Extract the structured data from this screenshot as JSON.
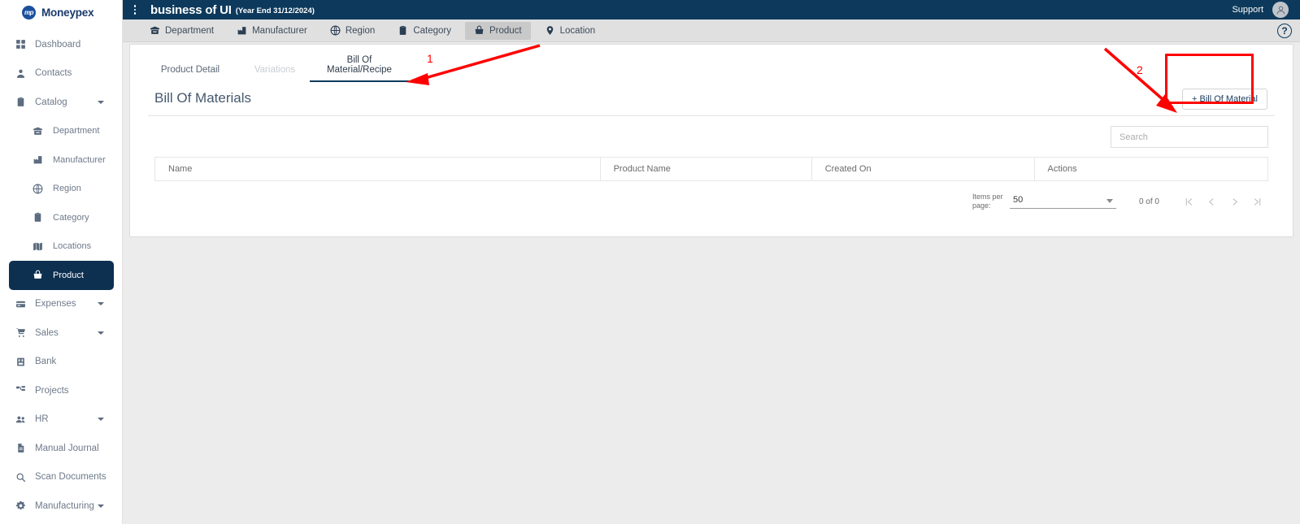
{
  "brand": {
    "name": "Moneypex",
    "logo_mark": "mp",
    "accent": "#1a3a6b"
  },
  "sidebar": {
    "items": [
      {
        "label": "Dashboard",
        "icon": "grid-icon",
        "level": 0,
        "caret": false,
        "active": false
      },
      {
        "label": "Contacts",
        "icon": "person-icon",
        "level": 0,
        "caret": false,
        "active": false
      },
      {
        "label": "Catalog",
        "icon": "clipboard-icon",
        "level": 0,
        "caret": true,
        "active": false
      },
      {
        "label": "Department",
        "icon": "archive-icon",
        "level": 1,
        "caret": false,
        "active": false
      },
      {
        "label": "Manufacturer",
        "icon": "factory-icon",
        "level": 1,
        "caret": false,
        "active": false
      },
      {
        "label": "Region",
        "icon": "globe-icon",
        "level": 1,
        "caret": false,
        "active": false
      },
      {
        "label": "Category",
        "icon": "clipboard-icon",
        "level": 1,
        "caret": false,
        "active": false
      },
      {
        "label": "Locations",
        "icon": "map-icon",
        "level": 1,
        "caret": false,
        "active": false
      },
      {
        "label": "Product",
        "icon": "product-icon",
        "level": 1,
        "caret": false,
        "active": true
      },
      {
        "label": "Expenses",
        "icon": "card-icon",
        "level": 0,
        "caret": true,
        "active": false
      },
      {
        "label": "Sales",
        "icon": "cart-icon",
        "level": 0,
        "caret": true,
        "active": false
      },
      {
        "label": "Bank",
        "icon": "bank-icon",
        "level": 0,
        "caret": false,
        "active": false
      },
      {
        "label": "Projects",
        "icon": "sitemap-icon",
        "level": 0,
        "caret": false,
        "active": false
      },
      {
        "label": "HR",
        "icon": "people-icon",
        "level": 0,
        "caret": true,
        "active": false
      },
      {
        "label": "Manual Journal",
        "icon": "document-icon",
        "level": 0,
        "caret": false,
        "active": false
      },
      {
        "label": "Scan Documents",
        "icon": "search-icon",
        "level": 0,
        "caret": false,
        "active": false
      },
      {
        "label": "Manufacturing",
        "icon": "gears-icon",
        "level": 0,
        "caret": true,
        "active": false
      }
    ]
  },
  "topbar": {
    "kebab_icon": "kebab-menu-icon",
    "business_name": "business of UI",
    "year_end": "(Year End 31/12/2024)",
    "support_label": "Support",
    "avatar_icon": "user-avatar-icon",
    "background": "#0d3a5c"
  },
  "tabbar": {
    "tabs": [
      {
        "label": "Department",
        "icon": "archive-icon",
        "selected": false
      },
      {
        "label": "Manufacturer",
        "icon": "factory-icon",
        "selected": false
      },
      {
        "label": "Region",
        "icon": "globe-icon",
        "selected": false
      },
      {
        "label": "Category",
        "icon": "clipboard-icon",
        "selected": false
      },
      {
        "label": "Product",
        "icon": "product-icon",
        "selected": true
      },
      {
        "label": "Location",
        "icon": "pin-icon",
        "selected": false
      }
    ],
    "help_label": "?",
    "help_icon": "help-circle-icon"
  },
  "subtabs": [
    {
      "label": "Product Detail",
      "state": "normal"
    },
    {
      "label": "Variations",
      "state": "disabled"
    },
    {
      "label": "Bill Of Material/Recipe",
      "state": "active"
    }
  ],
  "panel": {
    "title": "Bill Of Materials",
    "add_button_label": "+ Bill Of Material",
    "add_button_icon": "plus-icon"
  },
  "search": {
    "placeholder": "Search",
    "value": "",
    "icon": "search-icon"
  },
  "table": {
    "columns": [
      "Name",
      "Product Name",
      "Created On",
      "Actions"
    ],
    "rows": []
  },
  "paginator": {
    "items_per_page_label": "Items per page:",
    "items_per_page_value": "50",
    "range_label": "0 of 0",
    "first_icon": "first-page-icon",
    "prev_icon": "chevron-left-icon",
    "next_icon": "chevron-right-icon",
    "last_icon": "last-page-icon",
    "first_glyph": "|‹",
    "prev_glyph": "‹",
    "next_glyph": "›",
    "last_glyph": "›|"
  },
  "annotations": {
    "color": "#ff0000",
    "marks": [
      {
        "number": "1",
        "target": "bill-of-material-recipe-subtab"
      },
      {
        "number": "2",
        "target": "add-bill-of-material-button"
      }
    ]
  }
}
